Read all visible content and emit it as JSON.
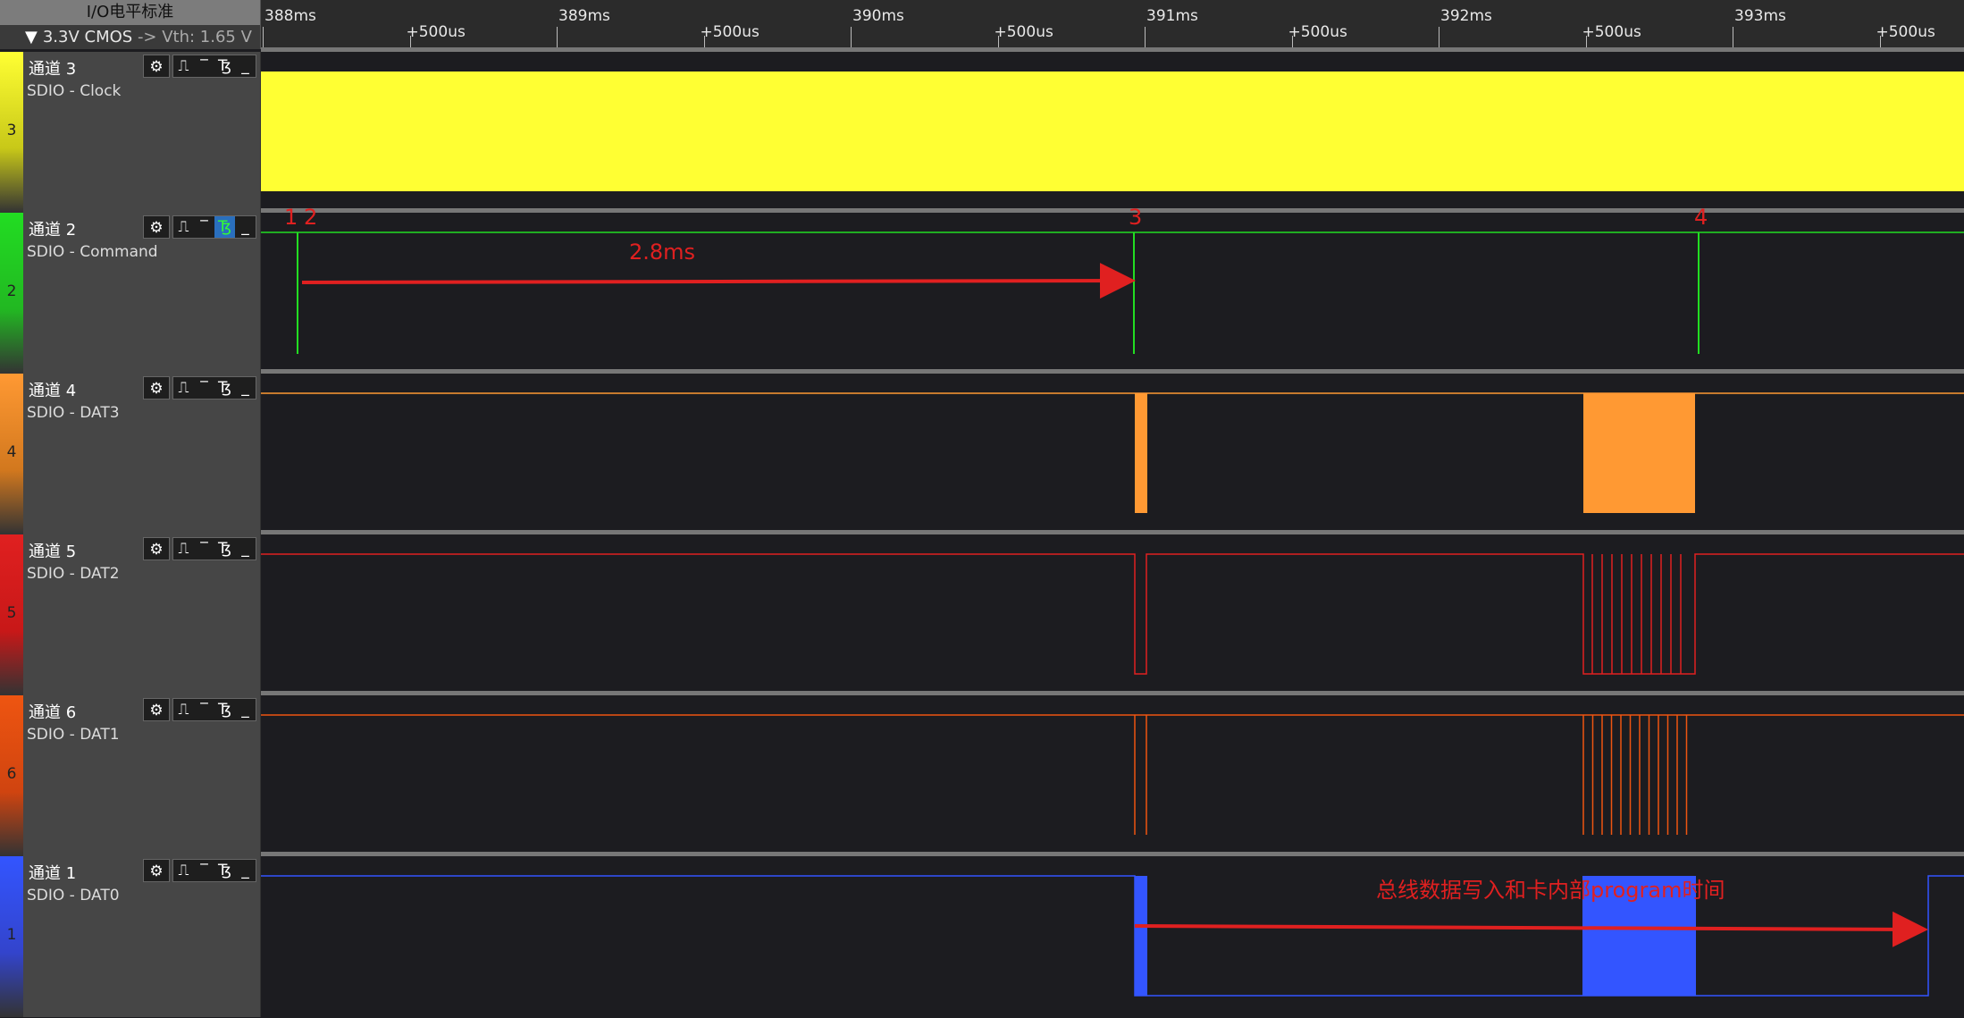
{
  "header": {
    "io_standard_label": "I/O电平标准",
    "logic_level": "3.3V CMOS",
    "vth_text": "-> Vth: 1.65 V",
    "dropdown_icon": "triangle-down-icon"
  },
  "ruler": {
    "labels": [
      {
        "text": "388ms",
        "kind": "major"
      },
      {
        "text": "+500us",
        "kind": "minor"
      },
      {
        "text": "389ms",
        "kind": "major"
      },
      {
        "text": "+500us",
        "kind": "minor"
      },
      {
        "text": "390ms",
        "kind": "major"
      },
      {
        "text": "+500us",
        "kind": "minor"
      },
      {
        "text": "391ms",
        "kind": "major"
      },
      {
        "text": "+500us",
        "kind": "minor"
      },
      {
        "text": "392ms",
        "kind": "major"
      },
      {
        "text": "+500us",
        "kind": "minor"
      },
      {
        "text": "393ms",
        "kind": "major"
      },
      {
        "text": "+500us",
        "kind": "minor"
      }
    ]
  },
  "channels": [
    {
      "index": "3",
      "name": "通道 3",
      "signal": "SDIO - Clock",
      "color": "#ffff33",
      "strip": "#c8c818",
      "fall_active": false
    },
    {
      "index": "2",
      "name": "通道 2",
      "signal": "SDIO - Command",
      "color": "#22dd22",
      "strip": "#22b822",
      "fall_active": true
    },
    {
      "index": "4",
      "name": "通道 4",
      "signal": "SDIO - DAT3",
      "color": "#ff9933",
      "strip": "#d2781e",
      "fall_active": false
    },
    {
      "index": "5",
      "name": "通道 5",
      "signal": "SDIO - DAT2",
      "color": "#e02020",
      "strip": "#c81818",
      "fall_active": false
    },
    {
      "index": "6",
      "name": "通道 6",
      "signal": "SDIO - DAT1",
      "color": "#ee5511",
      "strip": "#d04410",
      "fall_active": false
    },
    {
      "index": "1",
      "name": "通道 1",
      "signal": "SDIO - DAT0",
      "color": "#3355ff",
      "strip": "#3344cc",
      "fall_active": false
    }
  ],
  "toolbar_icons": [
    "gear-icon",
    "rising-edge-icon",
    "high-level-icon",
    "falling-edge-icon",
    "low-level-icon"
  ],
  "annotations": {
    "markers": [
      "1",
      "2",
      "3",
      "4"
    ],
    "duration_label": "2.8ms",
    "program_label": "总线数据写入和卡内部program时间"
  },
  "colors": {
    "annotation": "#e02020",
    "background": "#1c1c20"
  }
}
